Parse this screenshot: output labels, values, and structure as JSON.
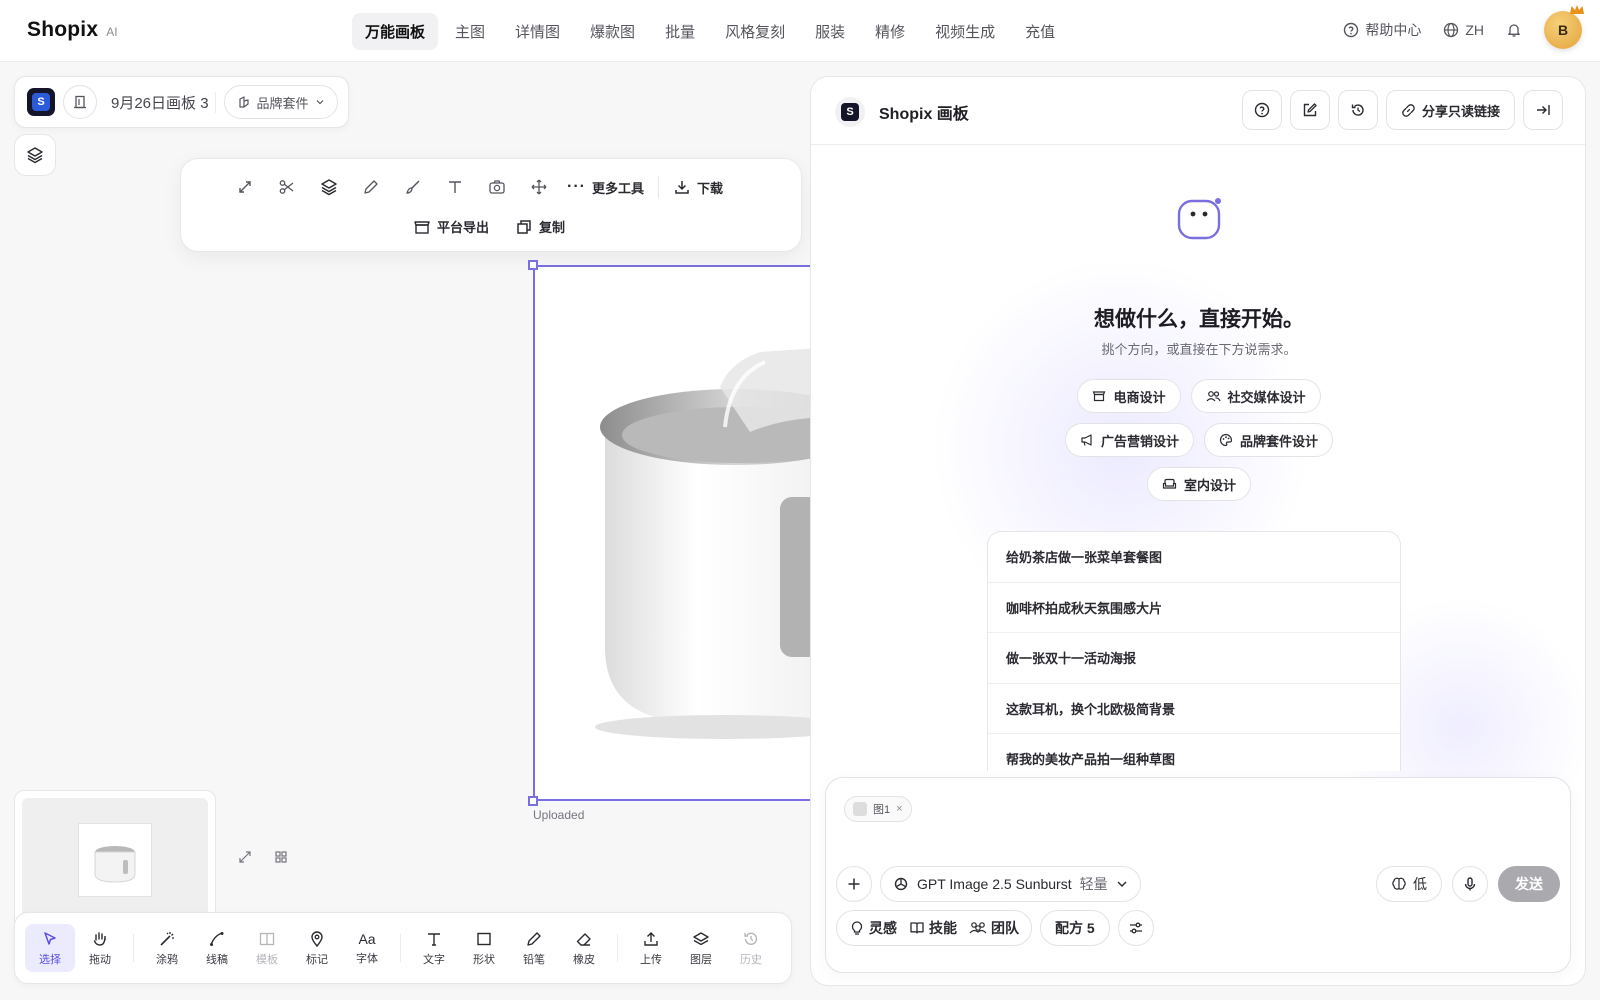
{
  "app": {
    "logo": "Shopix",
    "logo_suffix": "AI"
  },
  "nav": {
    "items": [
      {
        "label": "万能画板",
        "active": true
      },
      {
        "label": "主图"
      },
      {
        "label": "详情图"
      },
      {
        "label": "爆款图"
      },
      {
        "label": "批量"
      },
      {
        "label": "风格复刻"
      },
      {
        "label": "服装"
      },
      {
        "label": "精修"
      },
      {
        "label": "视频生成"
      },
      {
        "label": "充值"
      }
    ],
    "help": "帮助中心",
    "lang": "ZH",
    "avatar_letter": "B"
  },
  "project": {
    "badge": "S",
    "name": "9月26日画板 3",
    "kit": "品牌套件"
  },
  "floating_toolbar": {
    "more_tools": "更多工具",
    "download": "下载",
    "platform_export": "平台导出",
    "copy": "复制"
  },
  "canvas": {
    "image_label": "Uploaded"
  },
  "bottom_tools": [
    {
      "label": "选择",
      "icon": "cursor-icon",
      "active": true
    },
    {
      "label": "拖动",
      "icon": "hand-icon"
    },
    {
      "label": "涂鸦",
      "icon": "magic-wand-icon"
    },
    {
      "label": "线稿",
      "icon": "line-sketch-icon"
    },
    {
      "label": "模板",
      "icon": "template-icon",
      "disabled": true
    },
    {
      "label": "标记",
      "icon": "pin-icon"
    },
    {
      "label": "字体",
      "icon": "font-icon"
    },
    {
      "label": "文字",
      "icon": "text-icon"
    },
    {
      "label": "形状",
      "icon": "shape-icon"
    },
    {
      "label": "铅笔",
      "icon": "pencil-icon"
    },
    {
      "label": "橡皮",
      "icon": "eraser-icon"
    },
    {
      "label": "上传",
      "icon": "upload-icon"
    },
    {
      "label": "图层",
      "icon": "layers-icon"
    },
    {
      "label": "历史",
      "icon": "history-icon",
      "disabled": true
    }
  ],
  "panel": {
    "title": "Shopix 画板",
    "share": "分享只读链接",
    "hero_title": "想做什么，直接开始。",
    "hero_sub": "挑个方向，或直接在下方说需求。",
    "chips": [
      {
        "label": "电商设计",
        "icon": "store-icon"
      },
      {
        "label": "社交媒体设计",
        "icon": "users-icon"
      },
      {
        "label": "广告营销设计",
        "icon": "megaphone-icon"
      },
      {
        "label": "品牌套件设计",
        "icon": "palette-icon"
      },
      {
        "label": "室内设计",
        "icon": "sofa-icon"
      }
    ],
    "suggestions": [
      "给奶茶店做一张菜单套餐图",
      "咖啡杯拍成秋天氛围感大片",
      "做一张双十一活动海报",
      "这款耳机，换个北欧极简背景",
      "帮我的美妆产品拍一组种草图"
    ],
    "composer": {
      "attachment": "图1",
      "model": "GPT Image 2.5 Sunburst",
      "model_mode": "轻量",
      "quality": "低",
      "send": "发送",
      "inspiration": "灵感",
      "skills": "技能",
      "team": "团队",
      "recipe": "配方 5"
    }
  },
  "colors": {
    "accent": "#7a6fe0",
    "send_disabled": "#a9a9ae"
  }
}
